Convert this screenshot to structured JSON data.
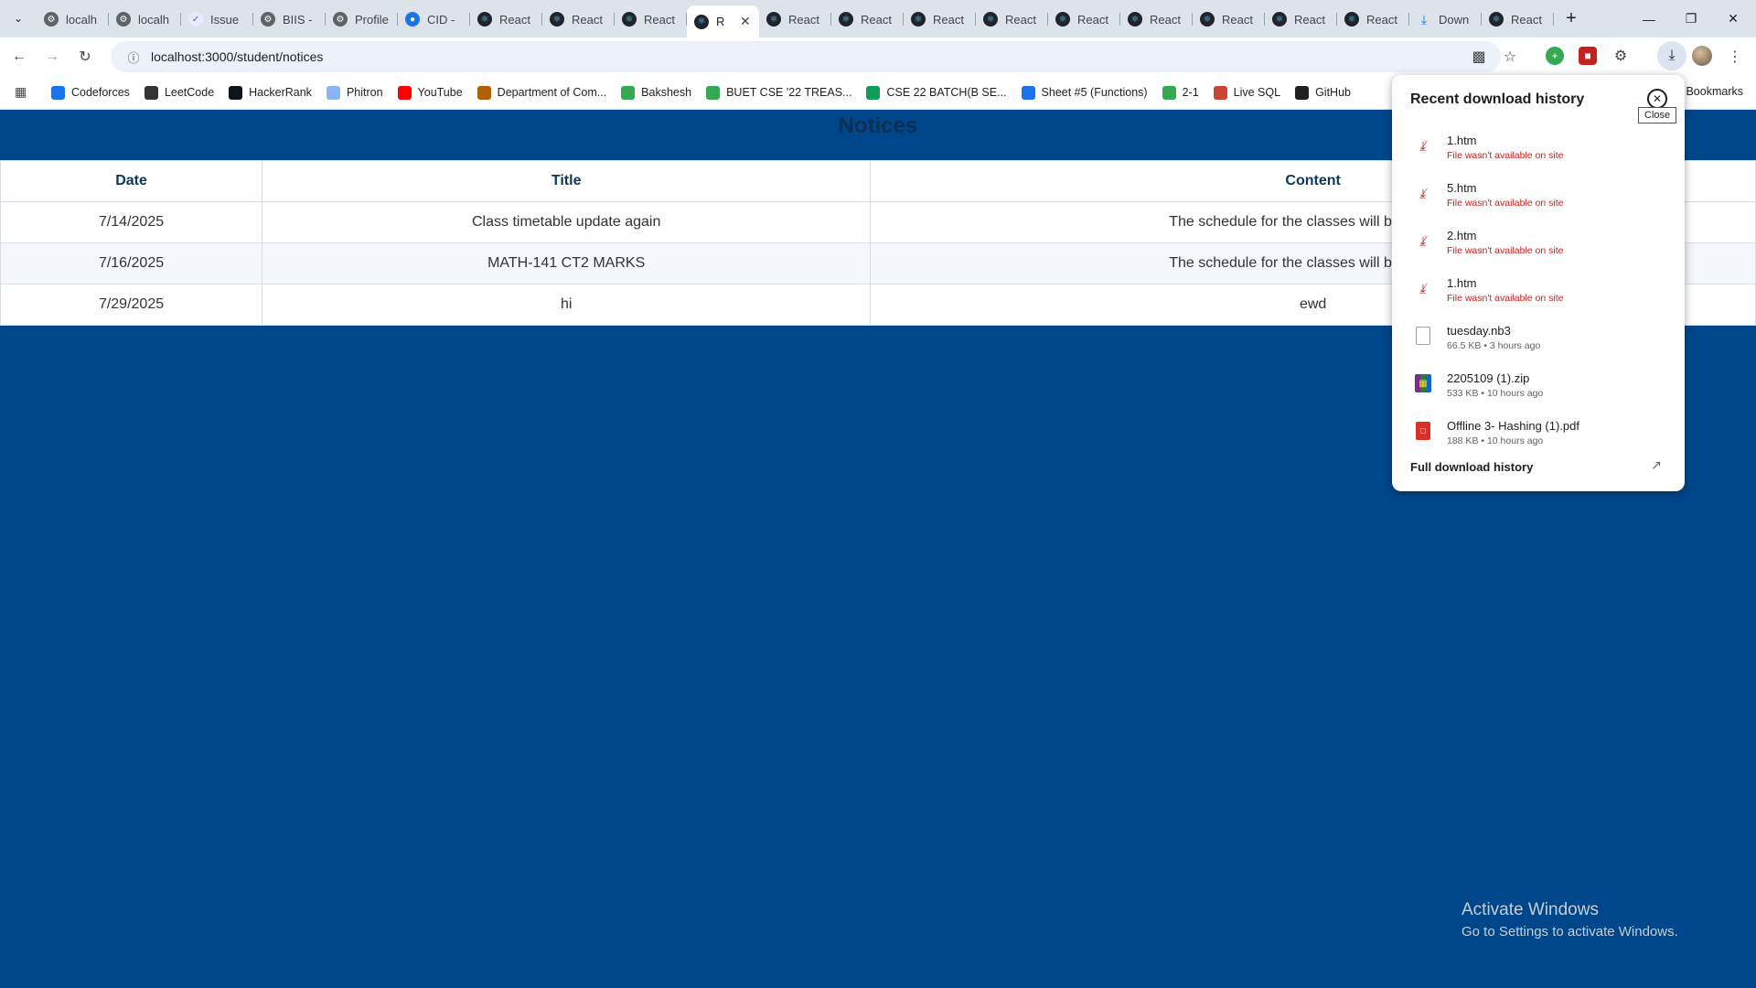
{
  "browser": {
    "tabs": [
      {
        "label": "localh",
        "icon": "gear"
      },
      {
        "label": "localh",
        "icon": "gear"
      },
      {
        "label": "Issue",
        "icon": "issue"
      },
      {
        "label": "BIIS -",
        "icon": "gear"
      },
      {
        "label": "Profile",
        "icon": "gear"
      },
      {
        "label": "CID -",
        "icon": "msg"
      },
      {
        "label": "React",
        "icon": "react"
      },
      {
        "label": "React",
        "icon": "react"
      },
      {
        "label": "React",
        "icon": "react"
      },
      {
        "label": "R",
        "icon": "react",
        "active": true
      },
      {
        "label": "React",
        "icon": "react"
      },
      {
        "label": "React",
        "icon": "react"
      },
      {
        "label": "React",
        "icon": "react"
      },
      {
        "label": "React",
        "icon": "react"
      },
      {
        "label": "React",
        "icon": "react"
      },
      {
        "label": "React",
        "icon": "react"
      },
      {
        "label": "React",
        "icon": "react"
      },
      {
        "label": "React",
        "icon": "react"
      },
      {
        "label": "React",
        "icon": "react"
      },
      {
        "label": "Down",
        "icon": "dl"
      },
      {
        "label": "React",
        "icon": "react"
      }
    ],
    "url": "localhost:3000/student/notices",
    "bookmarks": [
      {
        "label": "Codeforces",
        "color": "#1a73e8"
      },
      {
        "label": "LeetCode",
        "color": "#333333"
      },
      {
        "label": "HackerRank",
        "color": "#0e141e"
      },
      {
        "label": "Phitron",
        "color": "#8ab4f8"
      },
      {
        "label": "YouTube",
        "color": "#ff0000"
      },
      {
        "label": "Department of Com...",
        "color": "#b06000"
      },
      {
        "label": "Bakshesh",
        "color": "#34a853"
      },
      {
        "label": "BUET CSE '22 TREAS...",
        "color": "#34a853"
      },
      {
        "label": "CSE 22 BATCH(B SE...",
        "color": "#0f9d58"
      },
      {
        "label": "Sheet #5 (Functions)",
        "color": "#1a73e8"
      },
      {
        "label": "2-1",
        "color": "#34a853"
      },
      {
        "label": "Live SQL",
        "color": "#c74634"
      },
      {
        "label": "GitHub",
        "color": "#1f1f1f"
      }
    ],
    "bookmarks_right": "Bookmarks"
  },
  "page": {
    "title": "Notices",
    "table": {
      "headers": [
        "Date",
        "Title",
        "Content"
      ],
      "rows": [
        [
          "7/14/2025",
          "Class timetable update again",
          "The schedule for the classes will be updated"
        ],
        [
          "7/16/2025",
          "MATH-141 CT2 MARKS",
          "The schedule for the classes will be updated"
        ],
        [
          "7/29/2025",
          "hi",
          "ewd"
        ]
      ]
    },
    "watermark": {
      "line1": "Activate Windows",
      "line2": "Go to Settings to activate Windows."
    }
  },
  "downloads": {
    "heading": "Recent download history",
    "close_tooltip": "Close",
    "items": [
      {
        "name": "1.htm",
        "meta": "File wasn't available on site",
        "kind": "blocked"
      },
      {
        "name": "5.htm",
        "meta": "File wasn't available on site",
        "kind": "blocked"
      },
      {
        "name": "2.htm",
        "meta": "File wasn't available on site",
        "kind": "blocked"
      },
      {
        "name": "1.htm",
        "meta": "File wasn't available on site",
        "kind": "blocked"
      },
      {
        "name": "tuesday.nb3",
        "meta": "66.5 KB • 3 hours ago",
        "kind": "doc"
      },
      {
        "name": "2205109 (1).zip",
        "meta": "533 KB • 10 hours ago",
        "kind": "zip"
      },
      {
        "name": "Offline 3- Hashing (1).pdf",
        "meta": "188 KB • 10 hours ago",
        "kind": "pdf"
      }
    ],
    "full_history": "Full download history"
  }
}
